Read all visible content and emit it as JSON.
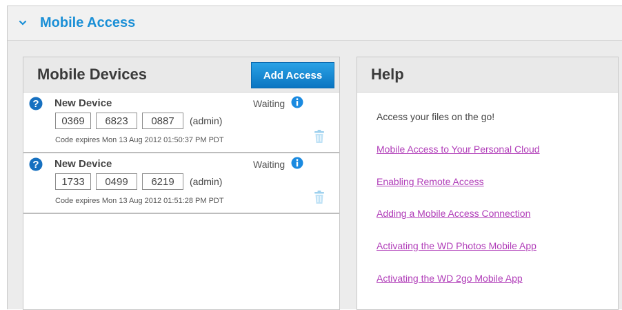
{
  "section": {
    "title": "Mobile Access",
    "accent": "#1a8fd6"
  },
  "devices_panel": {
    "title": "Mobile Devices",
    "add_button": "Add Access",
    "devices": [
      {
        "name": "New Device",
        "status": "Waiting",
        "codes": [
          "0369",
          "6823",
          "0887"
        ],
        "role": "(admin)",
        "expires": "Code expires Mon 13 Aug 2012 01:50:37 PM PDT"
      },
      {
        "name": "New Device",
        "status": "Waiting",
        "codes": [
          "1733",
          "0499",
          "6219"
        ],
        "role": "(admin)",
        "expires": "Code expires Mon 13 Aug 2012 01:51:28 PM PDT"
      }
    ]
  },
  "help_panel": {
    "title": "Help",
    "intro": "Access your files on the go!",
    "links": [
      "Mobile Access to Your Personal Cloud",
      "Enabling Remote Access",
      "Adding a Mobile Access Connection",
      "Activating the WD Photos Mobile App",
      "Activating the WD 2go Mobile App"
    ]
  },
  "icons": {
    "section_toggle": "chevron-down-icon",
    "device": "question-icon",
    "status_info": "info-icon",
    "delete": "trash-icon"
  },
  "colors": {
    "link": "#b03cb8",
    "button": "#1583d0"
  }
}
